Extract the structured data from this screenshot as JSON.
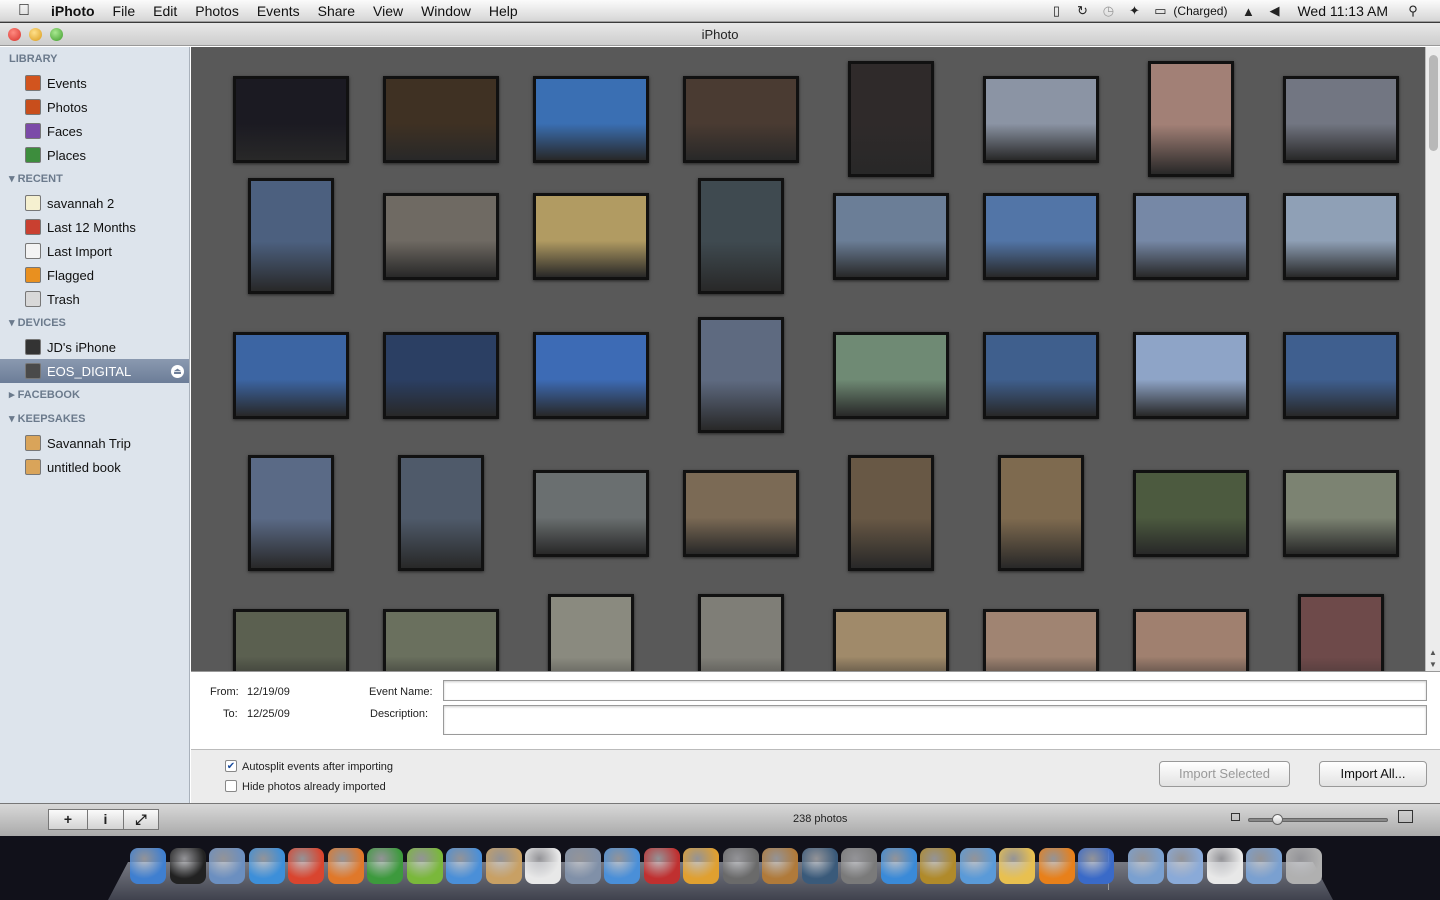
{
  "menubar": {
    "apple": "",
    "items": [
      "iPhoto",
      "File",
      "Edit",
      "Photos",
      "Events",
      "Share",
      "View",
      "Window",
      "Help"
    ],
    "battery": "(Charged)",
    "clock": "Wed 11:13 AM"
  },
  "window": {
    "title": "iPhoto"
  },
  "sidebar": {
    "library_header": "LIBRARY",
    "library": [
      {
        "label": "Events",
        "color": "#d2541e"
      },
      {
        "label": "Photos",
        "color": "#c84e1c"
      },
      {
        "label": "Faces",
        "color": "#7b4aa8"
      },
      {
        "label": "Places",
        "color": "#3d8d3d"
      }
    ],
    "recent_header": "RECENT",
    "recent": [
      {
        "label": "savannah 2",
        "color": "#f5f0d0"
      },
      {
        "label": "Last 12 Months",
        "color": "#c94030"
      },
      {
        "label": "Last Import",
        "color": "#f3f3f3"
      },
      {
        "label": "Flagged",
        "color": "#e9901f"
      },
      {
        "label": "Trash",
        "color": "#d8d8d8"
      }
    ],
    "devices_header": "DEVICES",
    "devices": [
      {
        "label": "JD's iPhone",
        "color": "#333333"
      },
      {
        "label": "EOS_DIGITAL",
        "color": "#4a4a4a"
      }
    ],
    "facebook_header": "FACEBOOK",
    "keepsakes_header": "KEEPSAKES",
    "keepsakes": [
      {
        "label": "Savannah Trip",
        "color": "#d9a45a"
      },
      {
        "label": "untitled book",
        "color": "#d9a45a"
      }
    ]
  },
  "photos": [
    {
      "o": "l",
      "c": "#1b1a22"
    },
    {
      "o": "l",
      "c": "#3f3123"
    },
    {
      "o": "l",
      "c": "#3a6fb3"
    },
    {
      "o": "l",
      "c": "#4a3b32"
    },
    {
      "o": "p",
      "c": "#2f2a2a"
    },
    {
      "o": "l",
      "c": "#8b94a4"
    },
    {
      "o": "p",
      "c": "#a28076"
    },
    {
      "o": "l",
      "c": "#727682"
    },
    {
      "o": "p",
      "c": "#4c607f"
    },
    {
      "o": "l",
      "c": "#6f6a63"
    },
    {
      "o": "l",
      "c": "#b19b62"
    },
    {
      "o": "p",
      "c": "#3f4a50"
    },
    {
      "o": "l",
      "c": "#6b7e97"
    },
    {
      "o": "l",
      "c": "#5275a7"
    },
    {
      "o": "l",
      "c": "#7688a6"
    },
    {
      "o": "l",
      "c": "#8fa0b6"
    },
    {
      "o": "l",
      "c": "#3c65a3"
    },
    {
      "o": "l",
      "c": "#2b3f63"
    },
    {
      "o": "l",
      "c": "#3d6bb5"
    },
    {
      "o": "p",
      "c": "#5e6a80"
    },
    {
      "o": "l",
      "c": "#6f8a74"
    },
    {
      "o": "l",
      "c": "#3f5f8d"
    },
    {
      "o": "l",
      "c": "#8ea4c7"
    },
    {
      "o": "l",
      "c": "#3f5f8f"
    },
    {
      "o": "p",
      "c": "#5a6a86"
    },
    {
      "o": "p",
      "c": "#4f5a6a"
    },
    {
      "o": "l",
      "c": "#6a6f70"
    },
    {
      "o": "l",
      "c": "#7b6a55"
    },
    {
      "o": "p",
      "c": "#685845"
    },
    {
      "o": "p",
      "c": "#7e6a4f"
    },
    {
      "o": "l",
      "c": "#4c5a3f"
    },
    {
      "o": "l",
      "c": "#7c8372"
    },
    {
      "o": "l",
      "c": "#5b6050"
    },
    {
      "o": "l",
      "c": "#6a705e"
    },
    {
      "o": "p",
      "c": "#8a8a7f"
    },
    {
      "o": "p",
      "c": "#7f7e77"
    },
    {
      "o": "l",
      "c": "#a08a6a"
    },
    {
      "o": "l",
      "c": "#a08472"
    },
    {
      "o": "l",
      "c": "#a0806f"
    },
    {
      "o": "p",
      "c": "#6e4a4a"
    }
  ],
  "info": {
    "from_label": "From:",
    "from_value": "12/19/09",
    "to_label": "To:",
    "to_value": "12/25/09",
    "event_name_label": "Event Name:",
    "event_name_value": "",
    "description_label": "Description:",
    "description_value": ""
  },
  "options": {
    "autosplit_label": "Autosplit events after importing",
    "autosplit_checked": true,
    "hide_label": "Hide photos already imported",
    "hide_checked": false,
    "import_selected": "Import Selected",
    "import_all": "Import All..."
  },
  "statusbar": {
    "count": "238 photos",
    "add_label": "+",
    "info_label": "i",
    "zoom_level": 0.18
  },
  "dock": [
    {
      "name": "finder-icon",
      "c": "#3f7fd0"
    },
    {
      "name": "dashboard-icon",
      "c": "#222"
    },
    {
      "name": "mail-icon",
      "c": "#6b8fc0"
    },
    {
      "name": "safari-icon",
      "c": "#3d8fd9"
    },
    {
      "name": "chrome-icon",
      "c": "#d9452f"
    },
    {
      "name": "firefox-icon",
      "c": "#e0782a"
    },
    {
      "name": "adium-icon",
      "c": "#3d9a3d"
    },
    {
      "name": "hulu-icon",
      "c": "#7ab83b"
    },
    {
      "name": "ichat-icon",
      "c": "#4a8fd8"
    },
    {
      "name": "address-book-icon",
      "c": "#c8a064"
    },
    {
      "name": "ical-icon",
      "c": "#e8e8e8"
    },
    {
      "name": "preview-icon",
      "c": "#8090a8"
    },
    {
      "name": "itunes-icon",
      "c": "#4a8fd8"
    },
    {
      "name": "photo-booth-icon",
      "c": "#c03030"
    },
    {
      "name": "iphoto-icon",
      "c": "#e0a030"
    },
    {
      "name": "imovie-icon",
      "c": "#6a6a6a"
    },
    {
      "name": "garageband-icon",
      "c": "#b07a3a"
    },
    {
      "name": "time-machine-icon",
      "c": "#3a5a7a"
    },
    {
      "name": "system-preferences-icon",
      "c": "#7a7a7a"
    },
    {
      "name": "skype-icon",
      "c": "#3a8ad8"
    },
    {
      "name": "warcraft-icon",
      "c": "#b08a2a"
    },
    {
      "name": "airport-icon",
      "c": "#5a9ad8"
    },
    {
      "name": "text-edit-icon",
      "c": "#e8c050"
    },
    {
      "name": "vlc-icon",
      "c": "#e8801a"
    },
    {
      "name": "sync-icon",
      "c": "#3a6ac8"
    },
    {
      "name": "applications-folder-icon",
      "c": "#7aa0d0"
    },
    {
      "name": "documents-folder-icon",
      "c": "#8aaad8"
    },
    {
      "name": "file-icon",
      "c": "#e8e8e8"
    },
    {
      "name": "downloads-folder-icon",
      "c": "#7aa0d0"
    },
    {
      "name": "trash-icon",
      "c": "#b0b0b0"
    }
  ]
}
